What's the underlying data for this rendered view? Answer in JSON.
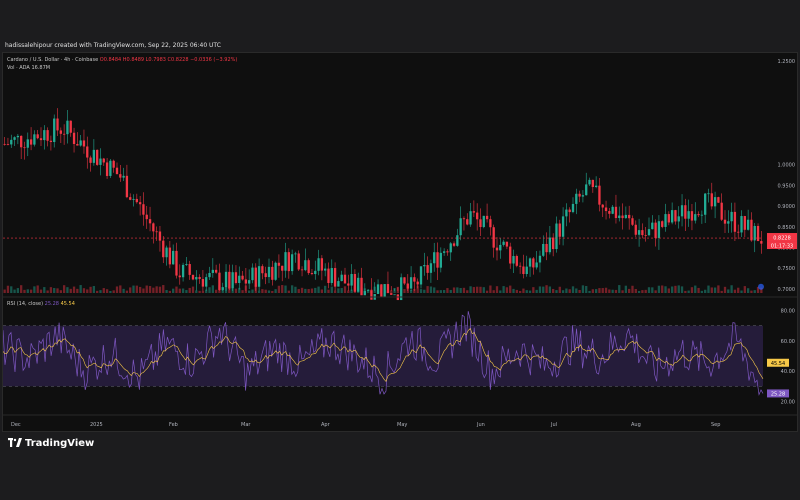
{
  "header": {
    "credit": "hadissalehipour created with TradingView.com, Sep 22, 2025 06:40 UTC"
  },
  "legend": {
    "symbol": "Cardano / U.S. Dollar · 4h · Coinbase",
    "ohlc": "O0.8484 H0.8489 L0.7983 C0.8228 −0.0336 (−3.92%)",
    "volume": "Vol · ADA  16.87M",
    "rsi_title": "RSI (14, close)",
    "rsi_value": "25.28",
    "rsi_ma_value": "45.54"
  },
  "price_panel": {
    "current_price_label": "0.8228",
    "countdown_label": "01:17:33",
    "scale_labels": [
      "1.2500",
      "1.0000",
      "0.9500",
      "0.9000",
      "0.8500",
      "0.8000",
      "0.7500",
      "0.7000"
    ]
  },
  "rsi_panel": {
    "scale_labels": [
      "80.00",
      "60.00",
      "40.00",
      "20.00"
    ],
    "ma_badge": "45.54",
    "rsi_badge": "25.28",
    "upper_band": 70,
    "lower_band": 30
  },
  "time_axis": {
    "labels": [
      "Dec",
      "2025",
      "Feb",
      "Mar",
      "Apr",
      "May",
      "Jun",
      "Jul",
      "Aug",
      "Sep"
    ]
  },
  "footer": {
    "brand": "TradingView",
    "icon": "tradingview-logo-icon"
  },
  "colors": {
    "up": "#22ab94",
    "down": "#f23645",
    "rsi_line": "#7e57c2",
    "rsi_ma": "#f7c948",
    "rsi_band_fill": "#2a1f45",
    "price_badge": "#f23645",
    "background": "#0f0f0f"
  },
  "chart_data": [
    {
      "type": "candlestick",
      "title": "Cardano / U.S. Dollar · 4h · Coinbase",
      "x": [
        "Dec",
        "2025",
        "Feb",
        "Mar",
        "Apr",
        "May",
        "Jun",
        "Jul",
        "Aug",
        "Sep"
      ],
      "close": [
        1.05,
        1.09,
        0.97,
        0.74,
        0.71,
        0.78,
        0.705,
        0.7,
        0.88,
        0.74,
        0.94,
        0.83,
        0.91,
        0.8228
      ],
      "ylim": [
        0.69,
        1.26
      ],
      "grid": false
    },
    {
      "type": "line",
      "title": "RSI (14, close)",
      "series": [
        {
          "name": "RSI",
          "values": [
            55,
            48,
            63,
            40,
            52,
            35,
            58,
            46,
            67,
            38,
            55,
            44,
            60,
            50,
            36,
            62,
            47,
            72,
            39,
            55,
            43,
            58,
            49,
            65,
            41,
            53,
            45,
            61,
            25.28
          ]
        },
        {
          "name": "MA",
          "values": [
            52,
            51,
            54,
            48,
            50,
            45,
            52,
            49,
            56,
            46,
            51,
            48,
            53,
            50,
            45,
            54,
            49,
            59,
            47,
            51,
            47,
            53,
            50,
            56,
            47,
            51,
            48,
            55,
            45.54
          ]
        }
      ],
      "ylim": [
        15,
        85
      ]
    }
  ]
}
